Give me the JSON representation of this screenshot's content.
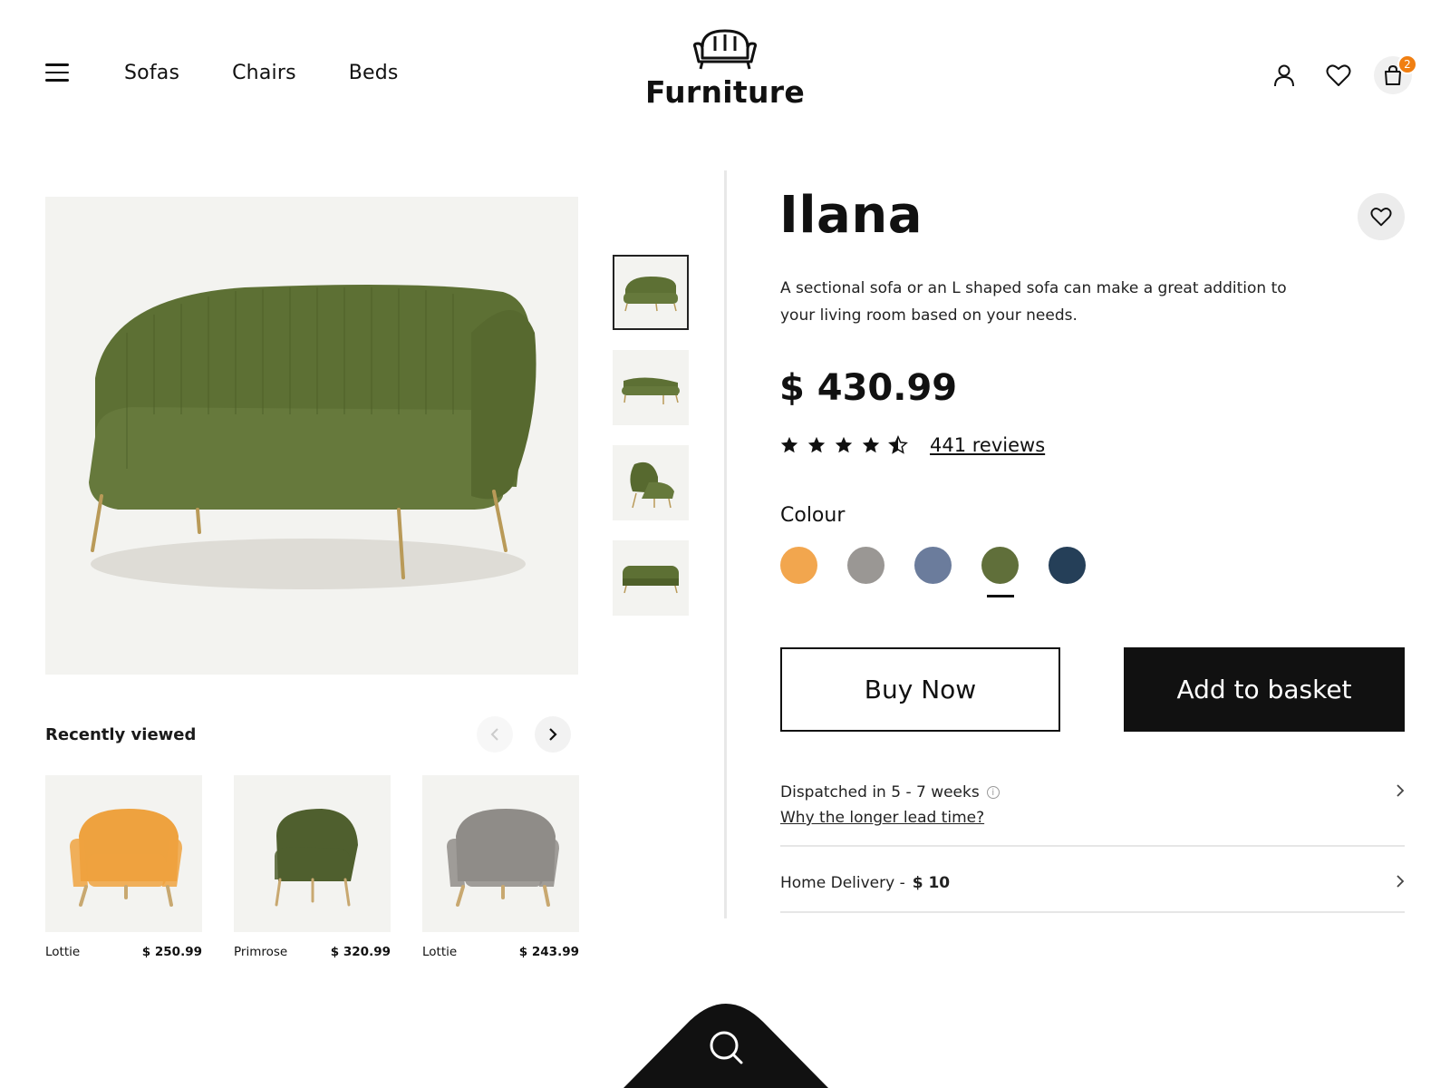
{
  "header": {
    "nav": [
      "Sofas",
      "Chairs",
      "Beds"
    ],
    "brand": "Furniture",
    "cart_count": "2"
  },
  "product": {
    "name": "Ilana",
    "description": "A sectional sofa or an L shaped sofa can make a great addition to your living room based on your needs.",
    "price": "$ 430.99",
    "rating": 4.5,
    "reviews_label": "441 reviews",
    "colour_label": "Colour",
    "colours": [
      "#f2a64e",
      "#9a9794",
      "#6b7c9c",
      "#606f3a",
      "#253f58"
    ],
    "selected_colour_index": 3,
    "buy_label": "Buy Now",
    "basket_label": "Add to basket",
    "dispatch_text": "Dispatched in 5 - 7 weeks",
    "lead_time_link": "Why the longer lead time?",
    "delivery_text": "Home Delivery -",
    "delivery_price": "$ 10"
  },
  "recently_viewed": {
    "title": "Recently viewed",
    "items": [
      {
        "name": "Lottie",
        "price": "$ 250.99",
        "colour": "#eea23f"
      },
      {
        "name": "Primrose",
        "price": "$ 320.99",
        "colour": "#4f5f2e"
      },
      {
        "name": "Lottie",
        "price": "$ 243.99",
        "colour": "#8f8c88"
      }
    ]
  },
  "icons": {
    "menu": "hamburger-icon",
    "account": "user-icon",
    "wishlist": "heart-icon",
    "cart": "bag-icon",
    "search": "search-icon"
  }
}
